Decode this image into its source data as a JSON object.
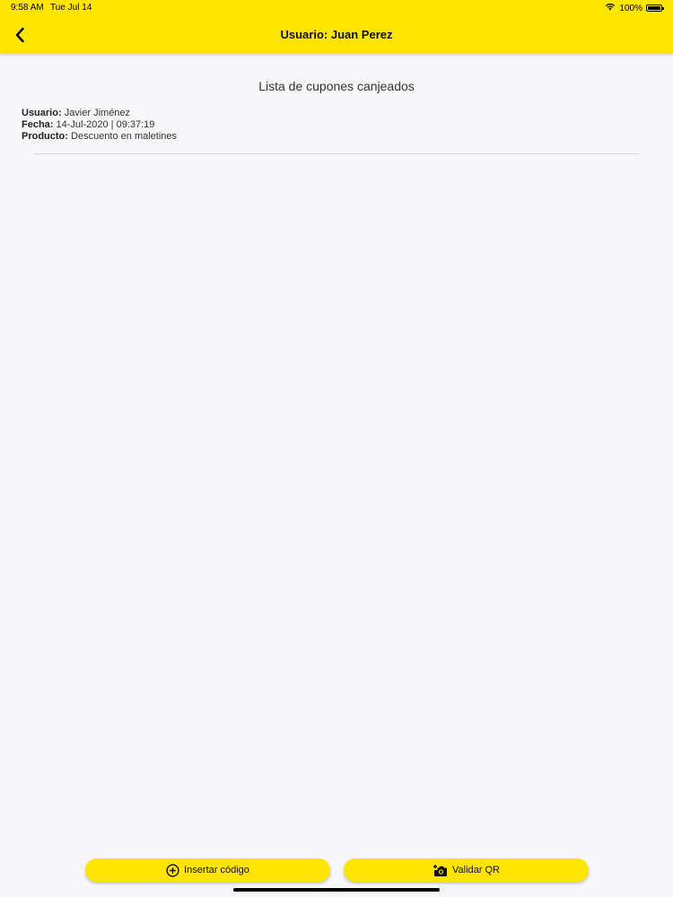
{
  "status_bar": {
    "time": "9:58 AM",
    "date": "Tue Jul 14",
    "battery": "100%",
    "wifi_icon": "wifi-icon",
    "battery_icon": "battery-icon"
  },
  "header": {
    "title": "Usuario: Juan Perez",
    "back_icon": "chevron-left-icon",
    "background": "#FFE500"
  },
  "main": {
    "section_title": "Lista de cupones canjeados",
    "coupons": [
      {
        "usuario_label": "Usuario:",
        "usuario": "Javier Jiménez",
        "fecha_label": "Fecha:",
        "fecha": "14-Jul-2020 | 09:37:19",
        "producto_label": "Producto:",
        "producto": "Descuento en maletines"
      }
    ]
  },
  "footer": {
    "insert_button": {
      "label": "Insertar código",
      "icon": "plus-circle-icon"
    },
    "validate_button": {
      "label": "Validar QR",
      "icon": "camera-add-icon"
    }
  },
  "colors": {
    "accent": "#FFE500",
    "background": "#F7F7F9"
  }
}
